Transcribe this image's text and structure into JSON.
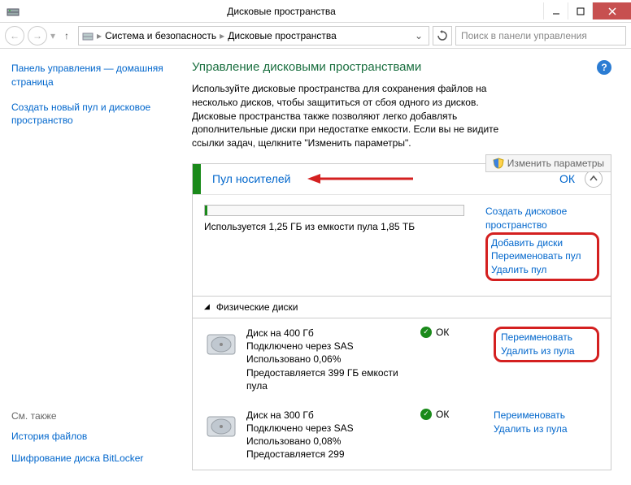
{
  "window": {
    "title": "Дисковые пространства"
  },
  "breadcrumb": {
    "level1": "Система и безопасность",
    "level2": "Дисковые пространства"
  },
  "search": {
    "placeholder": "Поиск в панели управления"
  },
  "sidebar": {
    "home": "Панель управления — домашняя страница",
    "create": "Создать новый пул и дисковое пространство",
    "see_also": "См. также",
    "history": "История файлов",
    "bitlocker": "Шифрование диска BitLocker"
  },
  "main": {
    "title": "Управление дисковыми пространствами",
    "desc": "Используйте дисковые пространства для сохранения файлов на несколько дисков, чтобы защититься от сбоя одного из дисков. Дисковые пространства также позволяют легко добавлять дополнительные диски при недостатке емкости. Если вы не видите ссылки задач, щелкните \"Изменить параметры\".",
    "change_params": "Изменить параметры"
  },
  "pool": {
    "title": "Пул носителей",
    "status": "ОК",
    "usage": "Используется 1,25 ГБ из емкости пула 1,85 ТБ",
    "links": {
      "create": "Создать дисковое пространство",
      "add": "Добавить диски",
      "rename": "Переименовать пул",
      "delete": "Удалить пул"
    }
  },
  "disks_header": "Физические диски",
  "disks": [
    {
      "name": "Диск на 400 Гб",
      "conn": "Подключено через SAS",
      "used": "Использовано 0,06%",
      "provides": "Предоставляется 399 ГБ емкости пула",
      "status": "ОК",
      "rename": "Переименовать",
      "remove": "Удалить из пула"
    },
    {
      "name": "Диск на 300 Гб",
      "conn": "Подключено через SAS",
      "used": "Использовано 0,08%",
      "provides": "Предоставляется 299",
      "status": "ОК",
      "rename": "Переименовать",
      "remove": "Удалить из пула"
    }
  ]
}
